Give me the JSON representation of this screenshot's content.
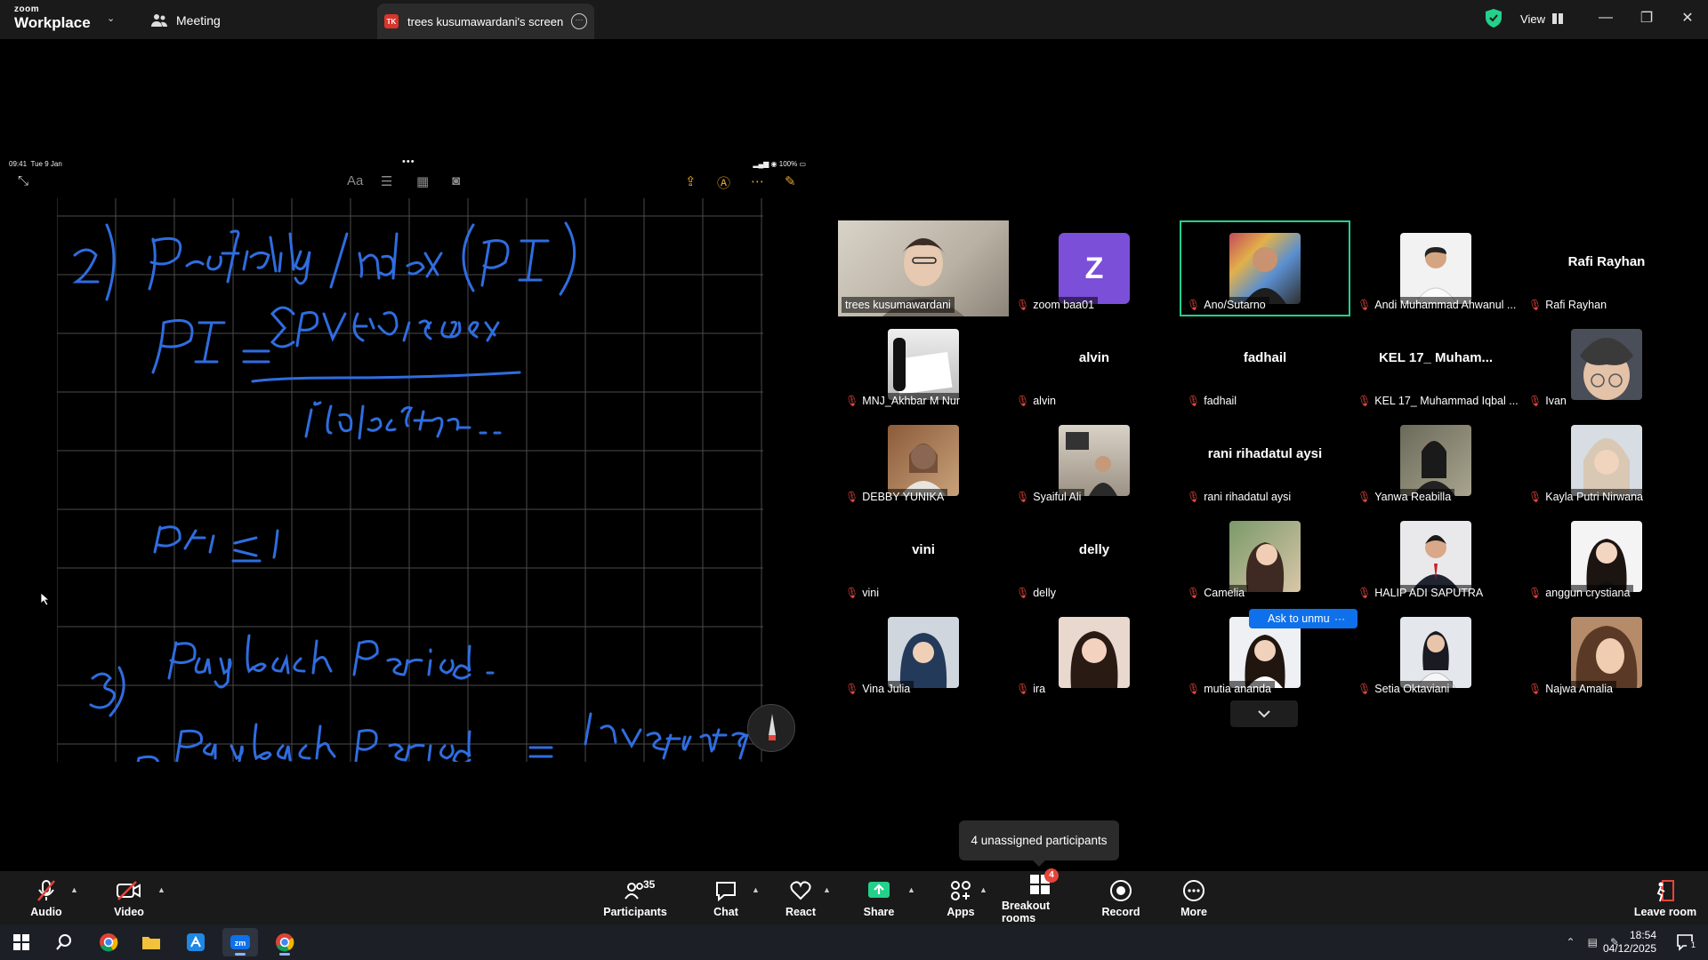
{
  "titlebar": {
    "logo_top": "zoom",
    "logo_bottom": "Workplace",
    "meeting_tab": "Meeting",
    "screen_tab_initials": "TK",
    "screen_tab_title": "trees kusumawardani's screen",
    "view_label": "View",
    "colors": {
      "brand": "#0e71eb",
      "secure": "#23d18b",
      "tab_badge": "#d9352c"
    }
  },
  "shared_screen": {
    "ipad_time": "09:41",
    "ipad_date": "Tue 9 Jan",
    "ipad_battery": "100%",
    "ink_color": "#2f6de0"
  },
  "participants": [
    {
      "name": "trees kusumawardani",
      "muted": false,
      "avatar": "photo",
      "wide": true
    },
    {
      "name": "zoom baa01",
      "muted": true,
      "avatar": "letter",
      "letter": "Z"
    },
    {
      "name": "Ano/Sutarno",
      "muted": true,
      "avatar": "photo",
      "active": true
    },
    {
      "name": "Andi Muhammad Ahwanul ...",
      "muted": true,
      "avatar": "photo"
    },
    {
      "name": "Rafi Rayhan",
      "muted": true,
      "avatar": "none",
      "display": "Rafi Rayhan"
    },
    {
      "name": "MNJ_Akhbar M Nur",
      "muted": true,
      "avatar": "photo"
    },
    {
      "name": "alvin",
      "muted": true,
      "avatar": "none",
      "display": "alvin"
    },
    {
      "name": "fadhail",
      "muted": true,
      "avatar": "none",
      "display": "fadhail"
    },
    {
      "name": "KEL 17_ Muhammad Iqbal ...",
      "muted": true,
      "avatar": "none",
      "display": "KEL 17_ Muham..."
    },
    {
      "name": "Ivan",
      "muted": true,
      "avatar": "photo"
    },
    {
      "name": "DEBBY YUNIKA",
      "muted": true,
      "avatar": "photo"
    },
    {
      "name": "Syaiful Ali",
      "muted": true,
      "avatar": "photo"
    },
    {
      "name": "rani rihadatul aysi",
      "muted": true,
      "avatar": "none",
      "display": "rani rihadatul aysi"
    },
    {
      "name": "Yanwa Reabilla",
      "muted": true,
      "avatar": "photo"
    },
    {
      "name": "Kayla Putri Nirwana",
      "muted": true,
      "avatar": "photo"
    },
    {
      "name": "vini",
      "muted": true,
      "avatar": "none",
      "display": "vini"
    },
    {
      "name": "delly",
      "muted": true,
      "avatar": "none",
      "display": "delly"
    },
    {
      "name": "Camelia",
      "muted": true,
      "avatar": "photo"
    },
    {
      "name": "HALIP ADI SAPUTRA",
      "muted": true,
      "avatar": "photo"
    },
    {
      "name": "anggun crystiana",
      "muted": true,
      "avatar": "photo"
    },
    {
      "name": "Vina Julia",
      "muted": true,
      "avatar": "photo"
    },
    {
      "name": "ira",
      "muted": true,
      "avatar": "photo"
    },
    {
      "name": "mutia ananda",
      "muted": true,
      "avatar": "photo"
    },
    {
      "name": "Setia Oktaviani",
      "muted": true,
      "avatar": "photo"
    },
    {
      "name": "Najwa Amalia",
      "muted": true,
      "avatar": "photo"
    }
  ],
  "hover": {
    "ask_unmute": "Ask to unmute",
    "more": "···"
  },
  "tooltip": "4 unassigned participants",
  "toolbar": {
    "audio": "Audio",
    "video": "Video",
    "participants": "Participants",
    "participant_count": "35",
    "chat": "Chat",
    "react": "React",
    "share": "Share",
    "apps": "Apps",
    "breakout": "Breakout rooms",
    "breakout_badge": "4",
    "record": "Record",
    "more": "More",
    "leave": "Leave room"
  },
  "taskbar": {
    "time": "18:54",
    "date": "04/12/2025",
    "notification_count": "1"
  }
}
